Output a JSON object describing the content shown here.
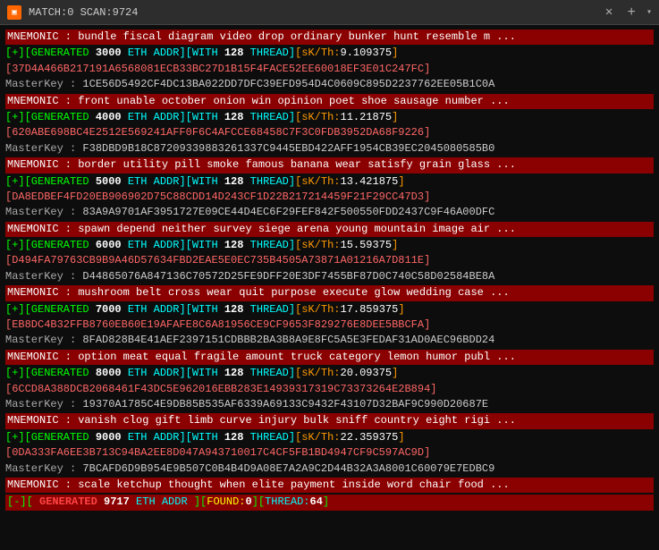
{
  "titleBar": {
    "icon": "▣",
    "text": "MATCH:0 SCAN:9724",
    "close": "✕",
    "plus": "+",
    "dropdown": "▾"
  },
  "lines": [
    {
      "type": "mnemonic",
      "text": "MNEMONIC : bundle fiscal diagram video drop ordinary bunker hunt resemble m ..."
    },
    {
      "type": "generated",
      "prefix": "[+][GENERATED ",
      "num": "3000",
      "mid": " ETH ADDR][WITH ",
      "thread": "128",
      "sk_label": " THREAD][sK/Th:",
      "sk_val": "9.109375",
      "suffix": "]"
    },
    {
      "type": "hash",
      "text": "[37D4A466B217191A6568081ECB33BC27D1B15F4FACE52EE60018EF3E01C247FC]"
    },
    {
      "type": "masterkey",
      "prefix": "MasterKey : ",
      "text": "1CE56D5492CF4DC13BA022DD7DFC39EFD954D4C0609C895D2237762EE05B1C0A"
    },
    {
      "type": "mnemonic",
      "text": "MNEMONIC : front unable october onion win opinion poet shoe sausage number ..."
    },
    {
      "type": "generated",
      "prefix": "[+][GENERATED ",
      "num": "4000",
      "mid": " ETH ADDR][WITH ",
      "thread": "128",
      "sk_label": " THREAD][sK/Th:",
      "sk_val": "11.21875",
      "suffix": "]"
    },
    {
      "type": "hash",
      "text": "[620ABE698BC4E2512E569241AFF0F6C4AFCCE68458C7F3C0FDB3952DA68F9226]"
    },
    {
      "type": "masterkey",
      "prefix": "MasterKey : ",
      "text": "F38DBD9B18C87209339883261337C9445EBD422AFF1954CB39EC2045080585B0"
    },
    {
      "type": "mnemonic",
      "text": "MNEMONIC : border utility pill smoke famous banana wear satisfy grain glass ..."
    },
    {
      "type": "generated",
      "prefix": "[+][GENERATED ",
      "num": "5000",
      "mid": " ETH ADDR][WITH ",
      "thread": "128",
      "sk_label": " THREAD][sK/Th:",
      "sk_val": "13.421875",
      "suffix": "]"
    },
    {
      "type": "hash",
      "text": "[DA8EDBEF4FD20EB906902D75C88CDD14D243CF1D22B217214459F21F29CC47D3]"
    },
    {
      "type": "masterkey",
      "prefix": "MasterKey : ",
      "text": "83A9A9701AF3951727E09CE44D4EC6F29FEF842F500550FDD2437C9F46A00DFC"
    },
    {
      "type": "mnemonic",
      "text": "MNEMONIC : spawn depend neither survey siege arena young mountain image air ..."
    },
    {
      "type": "generated",
      "prefix": "[+][GENERATED ",
      "num": "6000",
      "mid": " ETH ADDR][WITH ",
      "thread": "128",
      "sk_label": " THREAD][sK/Th:",
      "sk_val": "15.59375",
      "suffix": "]"
    },
    {
      "type": "hash",
      "text": "[D494FA79763CB9B9A46D57634FBD2EAE5E0EC735B4505A73871A01216A7D811E]"
    },
    {
      "type": "masterkey",
      "prefix": "MasterKey : ",
      "text": "D44865076A847136C70572D25FE9DFF20E3DF7455BF87D0C740C58D02584BE8A"
    },
    {
      "type": "mnemonic",
      "text": "MNEMONIC : mushroom belt cross wear quit purpose execute glow wedding case ..."
    },
    {
      "type": "generated",
      "prefix": "[+][GENERATED ",
      "num": "7000",
      "mid": " ETH ADDR][WITH ",
      "thread": "128",
      "sk_label": " THREAD][sK/Th:",
      "sk_val": "17.859375",
      "suffix": "]"
    },
    {
      "type": "hash",
      "text": "[EB8DC4B32FFB8760EB60E19AFAFE8C6A81956CE9CF9653F829276E8DEE5BBCFA]"
    },
    {
      "type": "masterkey",
      "prefix": "MasterKey : ",
      "text": "8FAD828B4E41AEF2397151CDBBB2BA3B8A9E8FC5A5E3FEDAF31AD0AEC96BDD24"
    },
    {
      "type": "mnemonic",
      "text": "MNEMONIC : option meat equal fragile amount truck category lemon humor publ ..."
    },
    {
      "type": "generated",
      "prefix": "[+][GENERATED ",
      "num": "8000",
      "mid": " ETH ADDR][WITH ",
      "thread": "128",
      "sk_label": " THREAD][sK/Th:",
      "sk_val": "20.09375",
      "suffix": "]"
    },
    {
      "type": "hash",
      "text": "[6CCD8A388DCB2068461F43DC5E962016EBB283E14939317319C73373264E2B894]"
    },
    {
      "type": "masterkey",
      "prefix": "MasterKey : ",
      "text": "19370A1785C4E9DB85B535AF6339A69133C9432F43107D32BAF9C990D20687E"
    },
    {
      "type": "mnemonic",
      "text": "MNEMONIC : vanish clog gift limb curve injury bulk sniff country eight rigi ..."
    },
    {
      "type": "generated",
      "prefix": "[+][GENERATED ",
      "num": "9000",
      "mid": " ETH ADDR][WITH ",
      "thread": "128",
      "sk_label": " THREAD][sK/Th:",
      "sk_val": "22.359375",
      "suffix": "]"
    },
    {
      "type": "hash",
      "text": "[0DA333FA6EE3B713C94BA2EE8D047A943710017C4CF5FB1BD4947CF9C597AC9D]"
    },
    {
      "type": "masterkey",
      "prefix": "MasterKey : ",
      "text": "7BCAFD6D9B954E9B507C0B4B4D9A08E7A2A9C2D44B32A3A8001C60079E7EDBC9"
    },
    {
      "type": "mnemonic",
      "text": "MNEMONIC : scale ketchup thought when elite payment inside word chair food ..."
    },
    {
      "type": "status",
      "prefix": "[-][",
      "label_gen": "GENERATED",
      "scan_num": "9717",
      "addr_label": " ETH ADDR ",
      "bracket_open": "][",
      "found_label": "FOUND:",
      "found_val": "0",
      "thread_label": "][THREAD:",
      "thread_val": "64",
      "suffix": "]"
    }
  ]
}
